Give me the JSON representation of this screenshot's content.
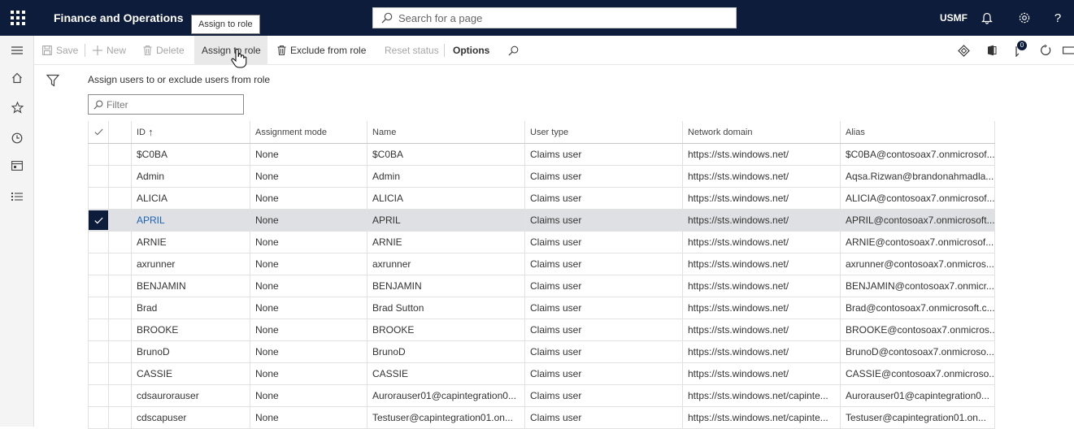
{
  "app": {
    "title": "Finance and Operations",
    "company": "USMF",
    "tooltip": "Assign to role"
  },
  "search": {
    "placeholder": "Search for a page"
  },
  "actions": {
    "save": "Save",
    "new": "New",
    "delete": "Delete",
    "assign_to_role": "Assign to role",
    "exclude_from_role": "Exclude from role",
    "reset_status": "Reset status",
    "options": "Options",
    "notification_count": "0"
  },
  "page": {
    "subtitle": "Assign users to or exclude users from role",
    "filter_placeholder": "Filter"
  },
  "grid": {
    "columns": {
      "id": "ID",
      "sort_glyph": "↑",
      "assignment_mode": "Assignment mode",
      "name": "Name",
      "user_type": "User type",
      "network_domain": "Network domain",
      "alias": "Alias"
    },
    "rows": [
      {
        "id": "$C0BA",
        "mode": "None",
        "name": "$C0BA",
        "type": "Claims user",
        "domain": "https://sts.windows.net/",
        "alias": "$C0BA@contosoax7.onmicrosof..."
      },
      {
        "id": "Admin",
        "mode": "None",
        "name": "Admin",
        "type": "Claims user",
        "domain": "https://sts.windows.net/",
        "alias": "Aqsa.Rizwan@brandonahmadla..."
      },
      {
        "id": "ALICIA",
        "mode": "None",
        "name": "ALICIA",
        "type": "Claims user",
        "domain": "https://sts.windows.net/",
        "alias": "ALICIA@contosoax7.onmicrosof..."
      },
      {
        "id": "APRIL",
        "mode": "None",
        "name": "APRIL",
        "type": "Claims user",
        "domain": "https://sts.windows.net/",
        "alias": "APRIL@contosoax7.onmicrosoft..."
      },
      {
        "id": "ARNIE",
        "mode": "None",
        "name": "ARNIE",
        "type": "Claims user",
        "domain": "https://sts.windows.net/",
        "alias": "ARNIE@contosoax7.onmicrosof..."
      },
      {
        "id": "axrunner",
        "mode": "None",
        "name": "axrunner",
        "type": "Claims user",
        "domain": "https://sts.windows.net/",
        "alias": "axrunner@contosoax7.onmicros..."
      },
      {
        "id": "BENJAMIN",
        "mode": "None",
        "name": "BENJAMIN",
        "type": "Claims user",
        "domain": "https://sts.windows.net/",
        "alias": "BENJAMIN@contosoax7.onmicr..."
      },
      {
        "id": "Brad",
        "mode": "None",
        "name": "Brad Sutton",
        "type": "Claims user",
        "domain": "https://sts.windows.net/",
        "alias": "Brad@contosoax7.onmicrosoft.c..."
      },
      {
        "id": "BROOKE",
        "mode": "None",
        "name": "BROOKE",
        "type": "Claims user",
        "domain": "https://sts.windows.net/",
        "alias": "BROOKE@contosoax7.onmicros..."
      },
      {
        "id": "BrunoD",
        "mode": "None",
        "name": "BrunoD",
        "type": "Claims user",
        "domain": "https://sts.windows.net/",
        "alias": "BrunoD@contosoax7.onmicroso..."
      },
      {
        "id": "CASSIE",
        "mode": "None",
        "name": "CASSIE",
        "type": "Claims user",
        "domain": "https://sts.windows.net/",
        "alias": "CASSIE@contosoax7.onmicroso..."
      },
      {
        "id": "cdsaurorauser",
        "mode": "None",
        "name": "Aurorauser01@capintegration0...",
        "type": "Claims user",
        "domain": "https://sts.windows.net/capinte...",
        "alias": "Aurorauser01@capintegration0..."
      },
      {
        "id": "cdscapuser",
        "mode": "None",
        "name": "Testuser@capintegration01.on...",
        "type": "Claims user",
        "domain": "https://sts.windows.net/capinte...",
        "alias": "Testuser@capintegration01.on..."
      }
    ]
  }
}
